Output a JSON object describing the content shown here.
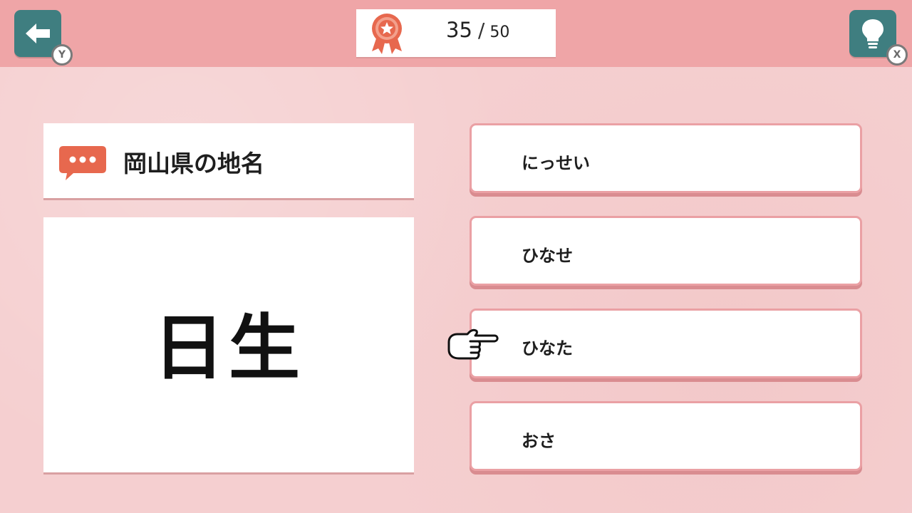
{
  "nav": {
    "back_icon": "arrow-left-icon",
    "back_key": "Y",
    "hint_icon": "lightbulb-icon",
    "hint_key": "X"
  },
  "score": {
    "icon": "medal-icon",
    "current": "35",
    "separator": "/",
    "total": "50"
  },
  "question": {
    "category_icon": "speech-bubble-icon",
    "category": "岡山県の地名",
    "kanji": "日生"
  },
  "answers": [
    {
      "label": "にっせい"
    },
    {
      "label": "ひなせ"
    },
    {
      "label": "ひなた"
    },
    {
      "label": "おさ"
    }
  ],
  "cursor": {
    "icon": "pointing-hand-icon",
    "target_index": 2
  },
  "colors": {
    "topbar": "#efa5a7",
    "background": "#f5cfd0",
    "button_teal": "#3f7e80",
    "accent_coral": "#e7684e",
    "answer_border": "#eaa0a4"
  }
}
